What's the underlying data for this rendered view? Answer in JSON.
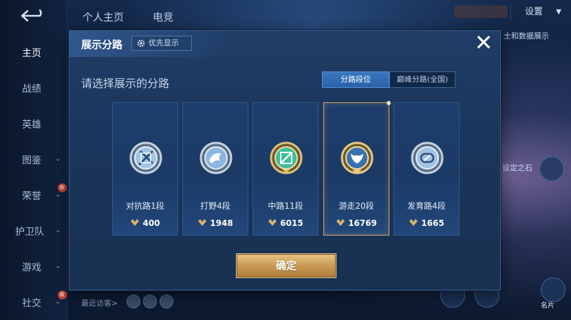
{
  "background": {
    "top_tabs": [
      "个人主页",
      "电竞"
    ],
    "settings_label": "设置",
    "right_text_1": "士和数据展示",
    "right_text_2": "设定之石",
    "recent_visitors_label": "最近访客>",
    "bottom_right_labels": [
      "",
      "名片"
    ]
  },
  "sidebar": {
    "items": [
      {
        "label": "主页",
        "active": true
      },
      {
        "label": "战绩"
      },
      {
        "label": "英雄"
      },
      {
        "label": "图鉴",
        "chevron": true
      },
      {
        "label": "荣誉",
        "chevron": true,
        "badge": "新"
      },
      {
        "label": "护卫队",
        "chevron": true
      },
      {
        "label": "游戏",
        "chevron": true
      },
      {
        "label": "社交",
        "chevron": true,
        "badge": "新"
      }
    ]
  },
  "modal": {
    "title": "展示分路",
    "prefer_label": "优先显示",
    "subtitle": "请选择展示的分路",
    "tabs": [
      {
        "label": "分路段位",
        "active": true
      },
      {
        "label": "巅峰分路(全国)",
        "active": false
      }
    ],
    "lanes": [
      {
        "name": "对抗路1段",
        "score": "400",
        "icon": "sword-shield-emblem-icon",
        "selected": false
      },
      {
        "name": "打野4段",
        "score": "1948",
        "icon": "dragon-emblem-icon",
        "selected": false
      },
      {
        "name": "中路11段",
        "score": "6015",
        "icon": "mid-lane-emblem-icon",
        "selected": false
      },
      {
        "name": "游走20段",
        "score": "16769",
        "icon": "wings-emblem-icon",
        "selected": true
      },
      {
        "name": "发育路4段",
        "score": "1665",
        "icon": "bow-emblem-icon",
        "selected": false
      }
    ],
    "confirm_label": "确定"
  },
  "colors": {
    "accent_blue": "#2a62a8",
    "gold": "#c99a52",
    "selected_border": "#e0a864"
  }
}
